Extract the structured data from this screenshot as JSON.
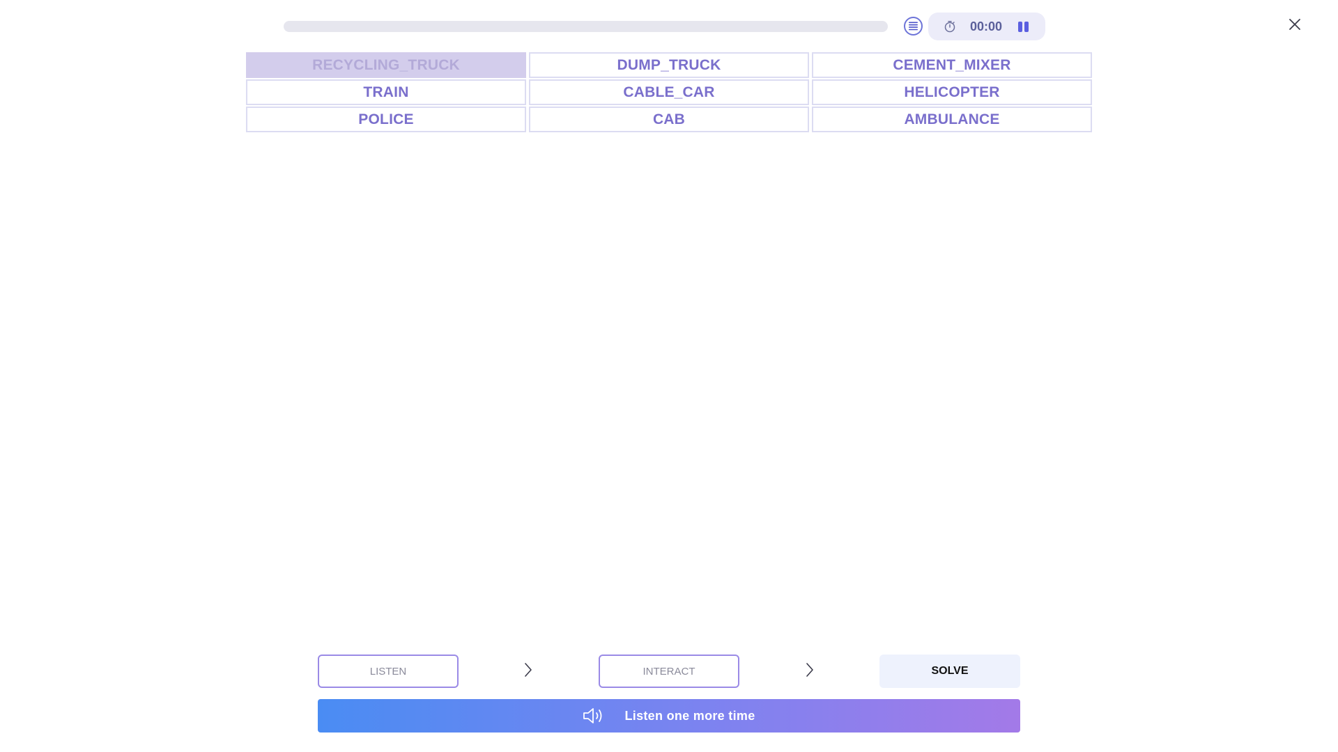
{
  "topbar": {
    "progress_fraction": 0,
    "timer": "00:00",
    "icons": {
      "list": "list-icon",
      "timer": "stopwatch-icon",
      "pause": "pause-icon",
      "close": "close-icon"
    }
  },
  "words": [
    {
      "label": "RECYCLING_TRUCK",
      "selected": true
    },
    {
      "label": "DUMP_TRUCK",
      "selected": false
    },
    {
      "label": "CEMENT_MIXER",
      "selected": false
    },
    {
      "label": "TRAIN",
      "selected": false
    },
    {
      "label": "CABLE_CAR",
      "selected": false
    },
    {
      "label": "HELICOPTER",
      "selected": false
    },
    {
      "label": "POLICE",
      "selected": false
    },
    {
      "label": "CAB",
      "selected": false
    },
    {
      "label": "AMBULANCE",
      "selected": false
    }
  ],
  "steps": {
    "listen": "LISTEN",
    "interact": "INTERACT",
    "solve": "SOLVE"
  },
  "listen_again": {
    "label": "Listen one more time",
    "icon": "speaker-icon"
  },
  "colors": {
    "accent": "#7a6fcc",
    "selected_tile": "#d3cdec",
    "gradient_start": "#4a8cf3",
    "gradient_end": "#a37ae8"
  }
}
